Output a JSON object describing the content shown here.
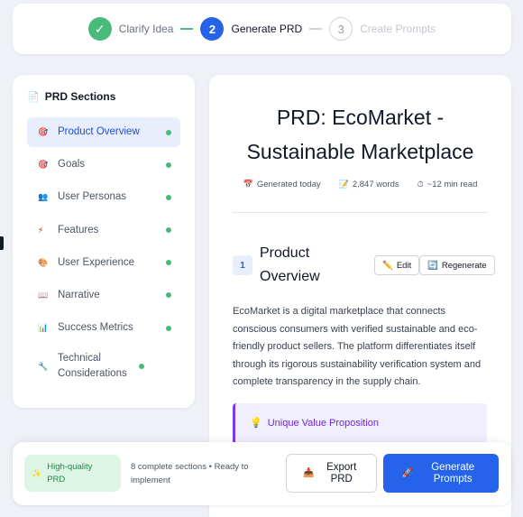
{
  "stepper": {
    "steps": [
      {
        "num": "✓",
        "label": "Clarify Idea",
        "state": "done"
      },
      {
        "num": "2",
        "label": "Generate PRD",
        "state": "active"
      },
      {
        "num": "3",
        "label": "Create Prompts",
        "state": "pending"
      }
    ]
  },
  "sidebar": {
    "title_icon": "📄",
    "title": "PRD Sections",
    "items": [
      {
        "icon": "🎯",
        "label": "Product Overview",
        "active": true
      },
      {
        "icon": "🎯",
        "label": "Goals"
      },
      {
        "icon": "👥",
        "label": "User Personas"
      },
      {
        "icon": "⚡",
        "label": "Features"
      },
      {
        "icon": "🎨",
        "label": "User Experience"
      },
      {
        "icon": "📖",
        "label": "Narrative"
      },
      {
        "icon": "📊",
        "label": "Success Metrics"
      },
      {
        "icon": "🔧",
        "label": "Technical Considerations"
      }
    ]
  },
  "document": {
    "title_line1": "PRD: EcoMarket -",
    "title_line2": "Sustainable Marketplace",
    "meta": {
      "generated_icon": "📅",
      "generated": "Generated today",
      "words_icon": "📝",
      "words": "2,847 words",
      "read_icon": "⏱",
      "read": "~12 min read"
    },
    "section": {
      "number": "1",
      "heading": "Product Overview",
      "edit_icon": "✏️",
      "edit_label": "Edit",
      "regen_icon": "🔄",
      "regen_label": "Regenerate",
      "body": "EcoMarket is a digital marketplace that connects conscious consumers with verified sustainable and eco-friendly product sellers. The platform differentiates itself through its rigorous sustainability verification system and complete transparency in the supply chain.",
      "uvp_icon": "💡",
      "uvp_title": "Unique Value Proposition"
    }
  },
  "action_bar": {
    "quality_icon": "✨",
    "quality_label": "High-quality PRD",
    "status": "8 complete sections • Ready to implement",
    "export_icon": "📥",
    "export_label": "Export PRD",
    "generate_icon": "🚀",
    "generate_label": "Generate Prompts"
  },
  "colors": {
    "primary": "#2563eb",
    "success": "#48bb78",
    "accent": "#7c3aed"
  }
}
